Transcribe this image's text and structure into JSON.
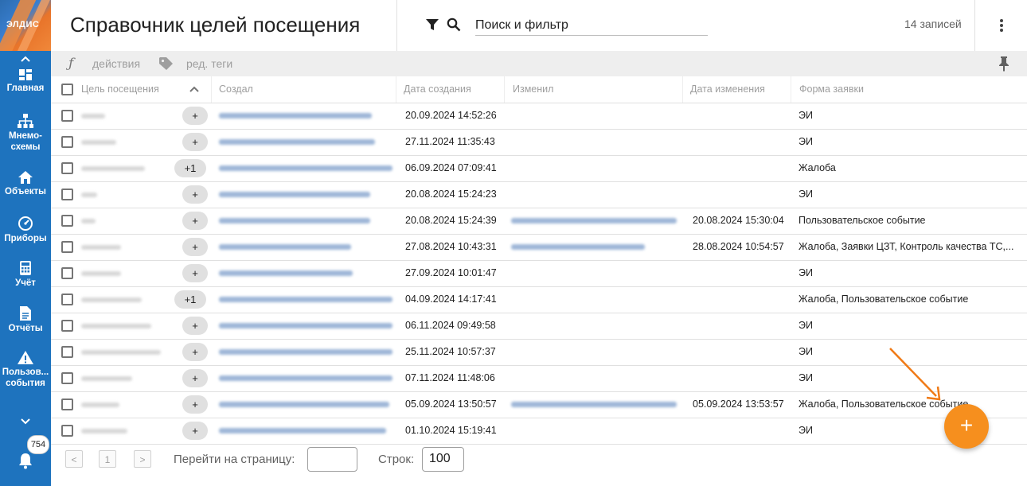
{
  "app": {
    "logo_text": "ЭЛДИС",
    "title": "Справочник целей посещения",
    "search_placeholder": "Поиск и фильтр",
    "records_count": "14 записей",
    "accent_color": "#1e73be",
    "fab_color": "#f68f1e"
  },
  "sidebar": {
    "items": [
      {
        "label": "Главная",
        "icon": "dashboard-icon"
      },
      {
        "label": "Мнемо-",
        "label2": "схемы",
        "icon": "sitemap-icon"
      },
      {
        "label": "Объекты",
        "icon": "home-icon"
      },
      {
        "label": "Приборы",
        "icon": "gauge-icon"
      },
      {
        "label": "Учёт",
        "icon": "calculator-icon"
      },
      {
        "label": "Отчёты",
        "icon": "document-icon"
      },
      {
        "label": "Пользов...",
        "label2": "события",
        "icon": "warning-icon"
      }
    ],
    "notifications_count": "754"
  },
  "toolbar": {
    "actions_label": "действия",
    "tags_label": "ред. теги"
  },
  "table": {
    "columns": [
      "Цель посещения",
      "Создал",
      "Дата создания",
      "Изменил",
      "Дата изменения",
      "Форма заявки"
    ],
    "rows": [
      {
        "tag": "+",
        "created": "20.09.2024 14:52:26",
        "modified": "",
        "form": "ЭИ"
      },
      {
        "tag": "+",
        "created": "27.11.2024 11:35:43",
        "modified": "",
        "form": "ЭИ"
      },
      {
        "tag": "+1",
        "created": "06.09.2024 07:09:41",
        "modified": "",
        "form": "Жалоба"
      },
      {
        "tag": "+",
        "created": "20.08.2024 15:24:23",
        "modified": "",
        "form": "ЭИ"
      },
      {
        "tag": "+",
        "created": "20.08.2024 15:24:39",
        "modified": "20.08.2024 15:30:04",
        "form": "Пользовательское событие"
      },
      {
        "tag": "+",
        "created": "27.08.2024 10:43:31",
        "modified": "28.08.2024 10:54:57",
        "form": "Жалоба, Заявки ЦЗТ, Контроль качества ТС,..."
      },
      {
        "tag": "+",
        "created": "27.09.2024 10:01:47",
        "modified": "",
        "form": "ЭИ"
      },
      {
        "tag": "+1",
        "created": "04.09.2024 14:17:41",
        "modified": "",
        "form": "Жалоба, Пользовательское событие"
      },
      {
        "tag": "+",
        "created": "06.11.2024 09:49:58",
        "modified": "",
        "form": "ЭИ"
      },
      {
        "tag": "+",
        "created": "25.11.2024 10:57:37",
        "modified": "",
        "form": "ЭИ"
      },
      {
        "tag": "+",
        "created": "07.11.2024 11:48:06",
        "modified": "",
        "form": "ЭИ"
      },
      {
        "tag": "+",
        "created": "05.09.2024 13:50:57",
        "modified": "05.09.2024 13:53:57",
        "form": "Жалоба, Пользовательское событие"
      },
      {
        "tag": "+",
        "created": "01.10.2024 15:19:41",
        "modified": "",
        "form": "ЭИ"
      }
    ]
  },
  "pager": {
    "prev": "<",
    "page": "1",
    "next": ">",
    "goto_label": "Перейти на страницу:",
    "rows_label": "Строк:",
    "rows_value": "100"
  },
  "fab": {
    "label": "+"
  }
}
